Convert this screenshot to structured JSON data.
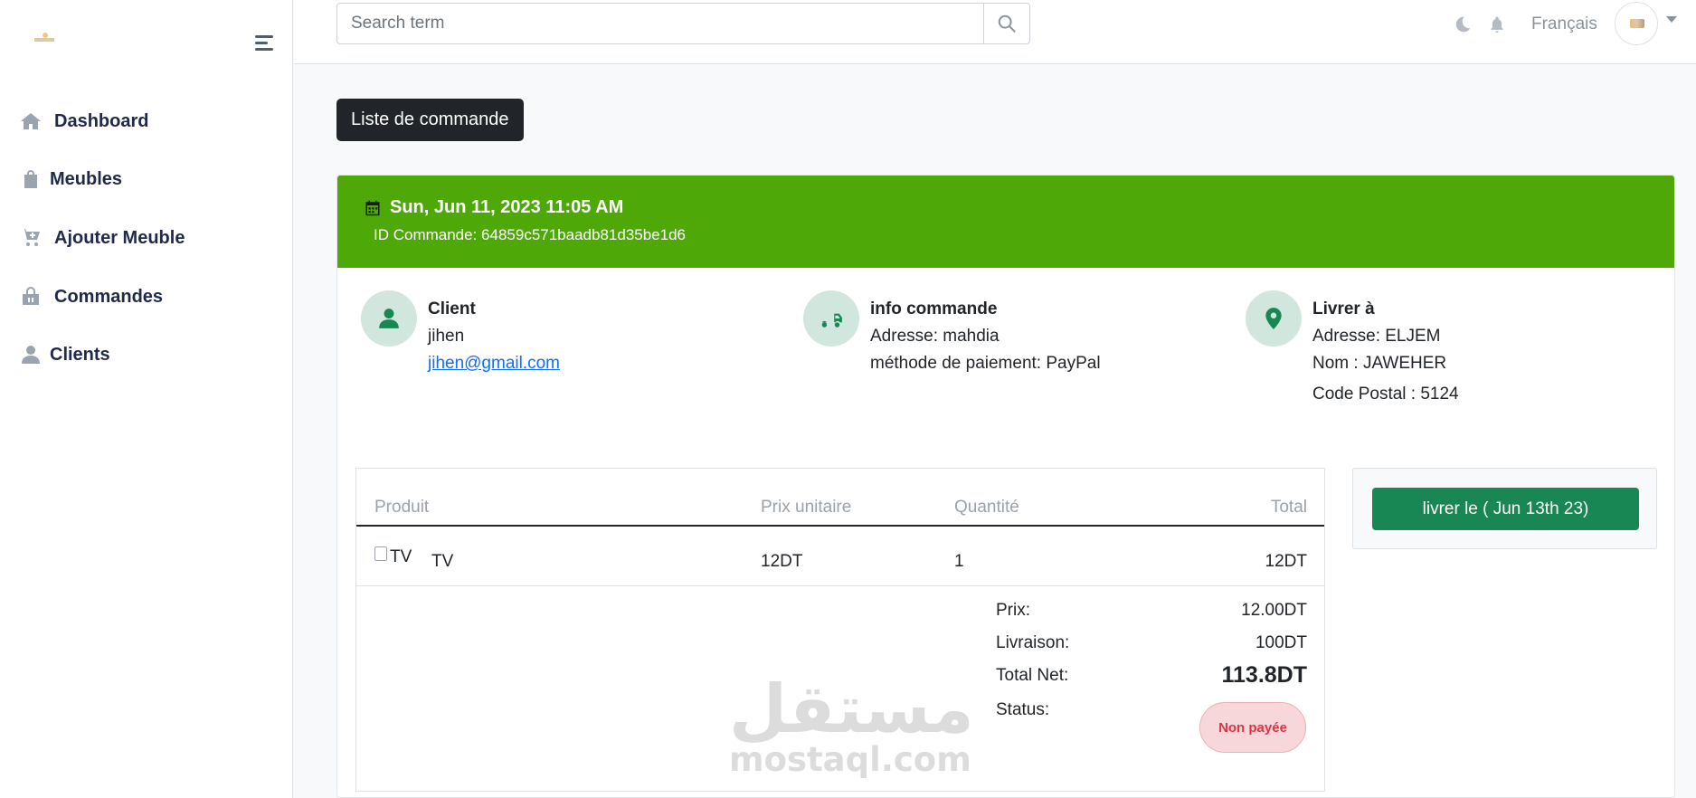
{
  "sidebar": {
    "items": [
      {
        "label": "Dashboard",
        "icon": "home-icon"
      },
      {
        "label": "Meubles",
        "icon": "shopping-bag-icon"
      },
      {
        "label": "Ajouter Meuble",
        "icon": "cart-plus-icon"
      },
      {
        "label": "Commandes",
        "icon": "shopping-basket-icon"
      },
      {
        "label": "Clients",
        "icon": "user-icon"
      }
    ]
  },
  "header": {
    "search_placeholder": "Search term",
    "language": "Français"
  },
  "main": {
    "list_button": "Liste de commande",
    "order": {
      "date": "Sun, Jun 11, 2023 11:05 AM",
      "id_text": "ID Commande: 64859c571baadb81d35be1d6",
      "client": {
        "title": "Client",
        "name": "jihen",
        "email": "jihen@gmail.com"
      },
      "order_info": {
        "title": "info commande",
        "address": "Adresse: mahdia",
        "payment": "méthode de paiement: PayPal"
      },
      "deliver_to": {
        "title": "Livrer à",
        "address": "Adresse: ELJEM",
        "name": "Nom : JAWEHER",
        "postal": "Code Postal : 5124"
      }
    },
    "table": {
      "headers": [
        "Produit",
        "Prix unitaire",
        "Quantité",
        "Total"
      ],
      "rows": [
        {
          "product": "TV",
          "unit_price": "12DT",
          "quantity": "1",
          "total": "12DT"
        }
      ]
    },
    "summary": {
      "prix_label": "Prix:",
      "prix_value": "12.00DT",
      "livraison_label": "Livraison:",
      "livraison_value": "100DT",
      "total_label": "Total Net:",
      "total_value": "113.8DT",
      "status_label": "Status:",
      "status_value": "Non payée"
    },
    "ship_button": "livrer le ( Jun 13th 23)"
  },
  "watermark": {
    "arabic": "مستقل",
    "latin": "mostaql.com"
  },
  "colors": {
    "header_green": "#4ea808",
    "action_green": "#198754",
    "badge_red": "#dc3545"
  }
}
